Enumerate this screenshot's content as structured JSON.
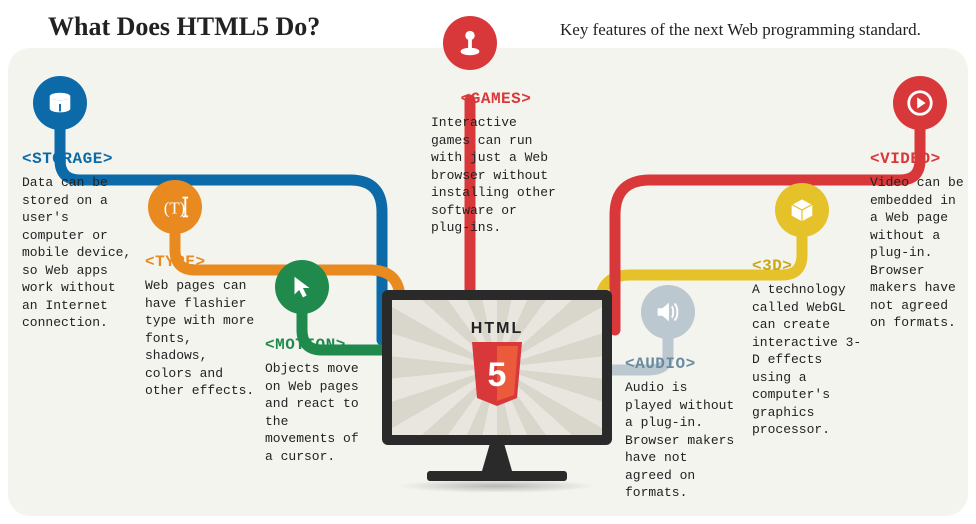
{
  "title": "What Does HTML5 Do?",
  "subtitle": "Key features of the next Web programming standard.",
  "center": {
    "label": "HTML",
    "badge_number": "5"
  },
  "colors": {
    "storage": "#0c6aa8",
    "type": "#e88a1f",
    "motion": "#1f8a4c",
    "games": "#d8383a",
    "audio": "#bcc8cf",
    "three_d": "#e6c22a",
    "video": "#d8383a"
  },
  "features": {
    "storage": {
      "tag": "<STORAGE>",
      "desc": "Data can be stored on a user's computer or mobile device, so Web apps work without an Internet connection.",
      "icon": "disk-icon"
    },
    "type": {
      "tag": "<TYPE>",
      "desc": "Web pages can have flashier type with more fonts, shadows, colors and other effects.",
      "icon": "text-cursor-icon"
    },
    "motion": {
      "tag": "<MOTION>",
      "desc": "Objects move on Web pages and react to the movements of a cursor.",
      "icon": "cursor-icon"
    },
    "games": {
      "tag": "<GAMES>",
      "desc": "Interactive games can run with just a Web browser without installing other software or plug-ins.",
      "icon": "joystick-icon"
    },
    "audio": {
      "tag": "<AUDIO>",
      "desc": "Audio is played without a plug-in. Browser makers have not agreed on formats.",
      "icon": "speaker-icon"
    },
    "three_d": {
      "tag": "<3D>",
      "desc": "A technology called WebGL can create interactive 3-D effects using a computer's graphics processor.",
      "icon": "cube-icon"
    },
    "video": {
      "tag": "<VIDEO>",
      "desc": "Video can be embedded in a Web page without a plug-in. Browser makers have not agreed on formats.",
      "icon": "play-icon"
    }
  }
}
